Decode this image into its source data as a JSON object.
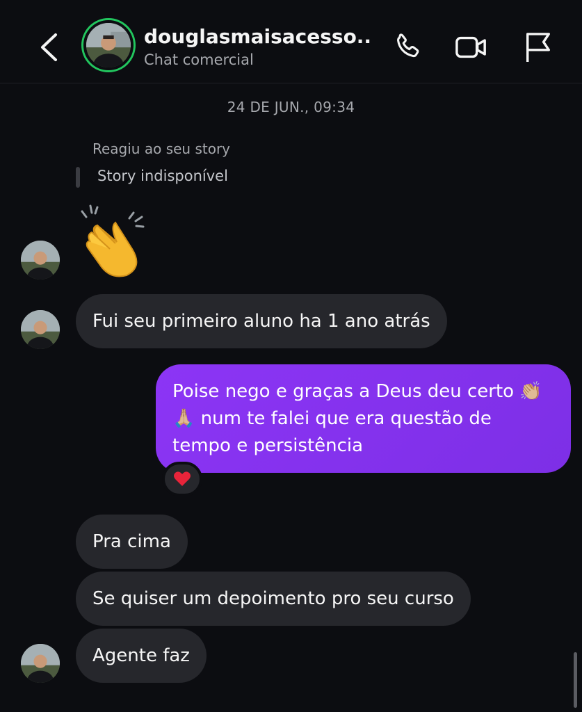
{
  "header": {
    "username": "douglasmaisacesso...",
    "subtitle": "Chat comercial",
    "ring_color": "#22c55e",
    "icons": [
      "chevron-left-icon",
      "phone-icon",
      "video-camera-icon",
      "flag-icon"
    ]
  },
  "thread": {
    "timestamp": "24 DE JUN., 09:34",
    "story_reaction": {
      "note": "Reagiu ao seu story",
      "unavailable": "Story indisponível",
      "reaction_emoji": "👏"
    },
    "messages": [
      {
        "direction": "incoming",
        "text": "Fui seu primeiro aluno ha 1 ano atrás"
      },
      {
        "direction": "outgoing",
        "text": "Poise nego e graças a Deus deu certo 👏🏼🙏🏼 num te falei que era questão de tempo e persistência",
        "reaction": "❤️"
      },
      {
        "direction": "incoming",
        "text": "Pra cima"
      },
      {
        "direction": "incoming",
        "text": "Se quiser um depoimento pro seu curso"
      },
      {
        "direction": "incoming",
        "text": "Agente faz"
      }
    ]
  },
  "colors": {
    "background": "#0c0d11",
    "incoming_bubble": "#26272c",
    "outgoing_bubble": "#8c35f5",
    "secondary_text": "#a7a9ae"
  }
}
